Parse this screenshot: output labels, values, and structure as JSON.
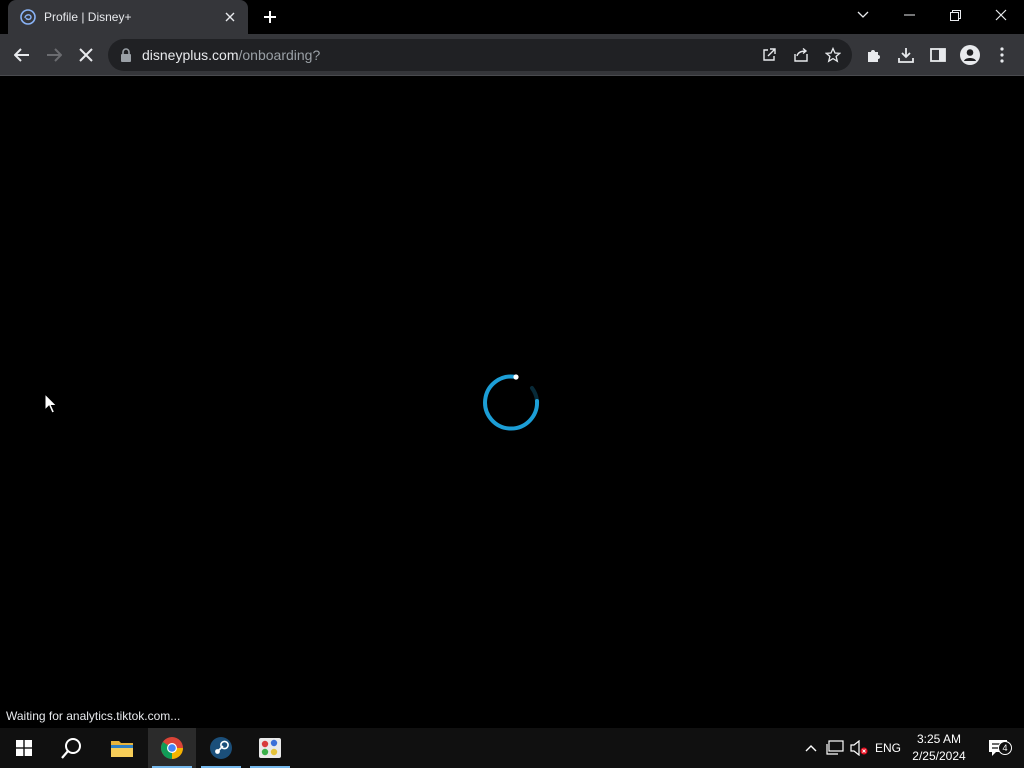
{
  "browser": {
    "tab": {
      "title": "Profile | Disney+",
      "favicon": "disney-plus-icon"
    },
    "omnibox": {
      "host": "disneyplus.com",
      "path": "/onboarding?"
    }
  },
  "content": {
    "status": "Waiting for analytics.tiktok.com...",
    "spinner_color": "#1ea7e1"
  },
  "taskbar": {
    "language": "ENG",
    "time": "3:25 AM",
    "date": "2/25/2024",
    "notification_count": "4"
  },
  "colors": {
    "tab_bg": "#35363a",
    "omnibox_bg": "#202124",
    "taskbar_bg": "#101010",
    "accent": "#76b9ed"
  }
}
